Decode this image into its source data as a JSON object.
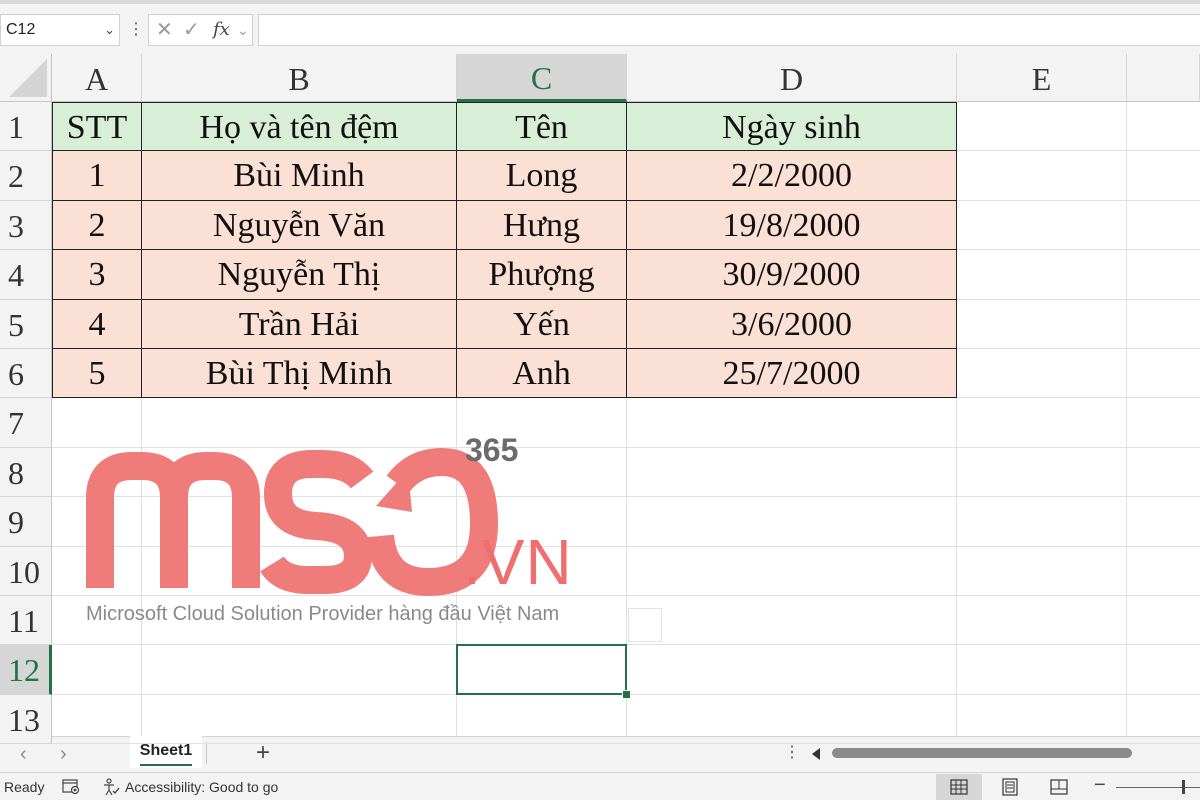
{
  "formula_bar": {
    "name_box": "C12",
    "name_box_icon": "chevron-down-icon",
    "more_icon": "more-vertical-icon",
    "cancel_glyph": "✕",
    "enter_glyph": "✓",
    "fx_label": "fx",
    "fx_chevron": "⌄",
    "formula_value": ""
  },
  "grid": {
    "columns": [
      "A",
      "B",
      "C",
      "D",
      "E"
    ],
    "rows": [
      "1",
      "2",
      "3",
      "4",
      "5",
      "6",
      "7",
      "8",
      "9",
      "10",
      "11",
      "12",
      "13"
    ],
    "selected_column": "C",
    "selected_row": "12",
    "header_row": [
      "STT",
      "Họ và tên đệm",
      "Tên",
      "Ngày sinh"
    ],
    "data_rows": [
      [
        "1",
        "Bùi Minh",
        "Long",
        "2/2/2000"
      ],
      [
        "2",
        "Nguyễn Văn",
        "Hưng",
        "19/8/2000"
      ],
      [
        "3",
        "Nguyễn Thị",
        "Phượng",
        "30/9/2000"
      ],
      [
        "4",
        "Trần Hải",
        "Yến",
        "3/6/2000"
      ],
      [
        "5",
        "Bùi Thị Minh",
        "Anh",
        "25/7/2000"
      ]
    ],
    "header_fill": "#d8eed6",
    "data_fill": "#fbe0d6",
    "accent": "#217346"
  },
  "watermark": {
    "brand": "MSO",
    "superscript": "365",
    "domain": ".VN",
    "tagline": "Microsoft Cloud Solution Provider hàng đầu Việt Nam",
    "brand_color": "#ef7b7b"
  },
  "tabs": {
    "prev_icon": "‹",
    "next_icon": "›",
    "sheets": [
      "Sheet1"
    ],
    "add_label": "+",
    "options_icon": "⋮"
  },
  "status": {
    "ready": "Ready",
    "accessibility": "Accessibility: Good to go",
    "zoom_minus": "−"
  }
}
